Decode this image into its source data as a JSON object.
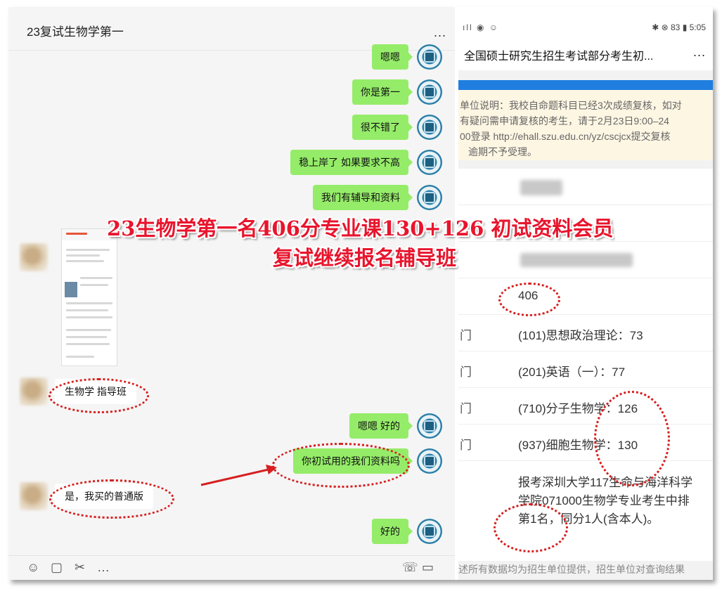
{
  "chat": {
    "title": "23复试生物学第一",
    "more": "...",
    "right_messages": [
      {
        "text": "嗯嗯"
      },
      {
        "text": "你是第一"
      },
      {
        "text": "很不错了"
      },
      {
        "text": "稳上岸了 如果要求不高"
      },
      {
        "text": "我们有辅导和资料"
      },
      {
        "text": "嗯嗯 好的"
      },
      {
        "text": "你初试用的我们资料吗"
      },
      {
        "text": "好的"
      }
    ],
    "left_messages": [
      {
        "text": "生物学 指导班"
      },
      {
        "text": "是，我买的普通版"
      }
    ],
    "toolbar": {
      "emoji": "☺",
      "folder": "▢",
      "scissors": "✂",
      "chat": "…",
      "phone": "☏",
      "video": "▭"
    }
  },
  "phone": {
    "status_left": "ıll ◉ ☺",
    "status_right": "✱ ⊗ 83 ▮ 5:05",
    "page_title": "全国硕士研究生招生考试部分考生初...",
    "more": "...",
    "notice_lines": [
      "单位说明：我校自命题科目已经3次成绩复核，如对",
      "有疑问需申请复核的考生，请于2月23日9:00–24",
      "00登录 http://ehall.szu.edu.cn/yz/cscjcx提交复核",
      "逾期不予受理。"
    ],
    "total_score": "406",
    "subjects": [
      {
        "key": "门",
        "value": "(101)思想政治理论：73"
      },
      {
        "key": "门",
        "value": "(201)英语（一）：77"
      },
      {
        "key": "门",
        "value": "(710)分子生物学：126"
      },
      {
        "key": "门",
        "value": "(937)细胞生物学：130"
      }
    ],
    "rank_lines": [
      "报考深圳大学117生命与海洋科学",
      "学院071000生物学专业考生中排",
      "第1名，同分1人(含本人)。"
    ],
    "footer": "述所有数据均为招生单位提供，招生单位对查询结果"
  },
  "overlay": {
    "line1": "23生物学第一名406分专业课130+126 初试资料会员",
    "line2": "复试继续报名辅导班"
  },
  "colors": {
    "bubble_green": "#95ec69",
    "accent_red": "#e8152d",
    "phone_blue": "#1f7ee0"
  }
}
